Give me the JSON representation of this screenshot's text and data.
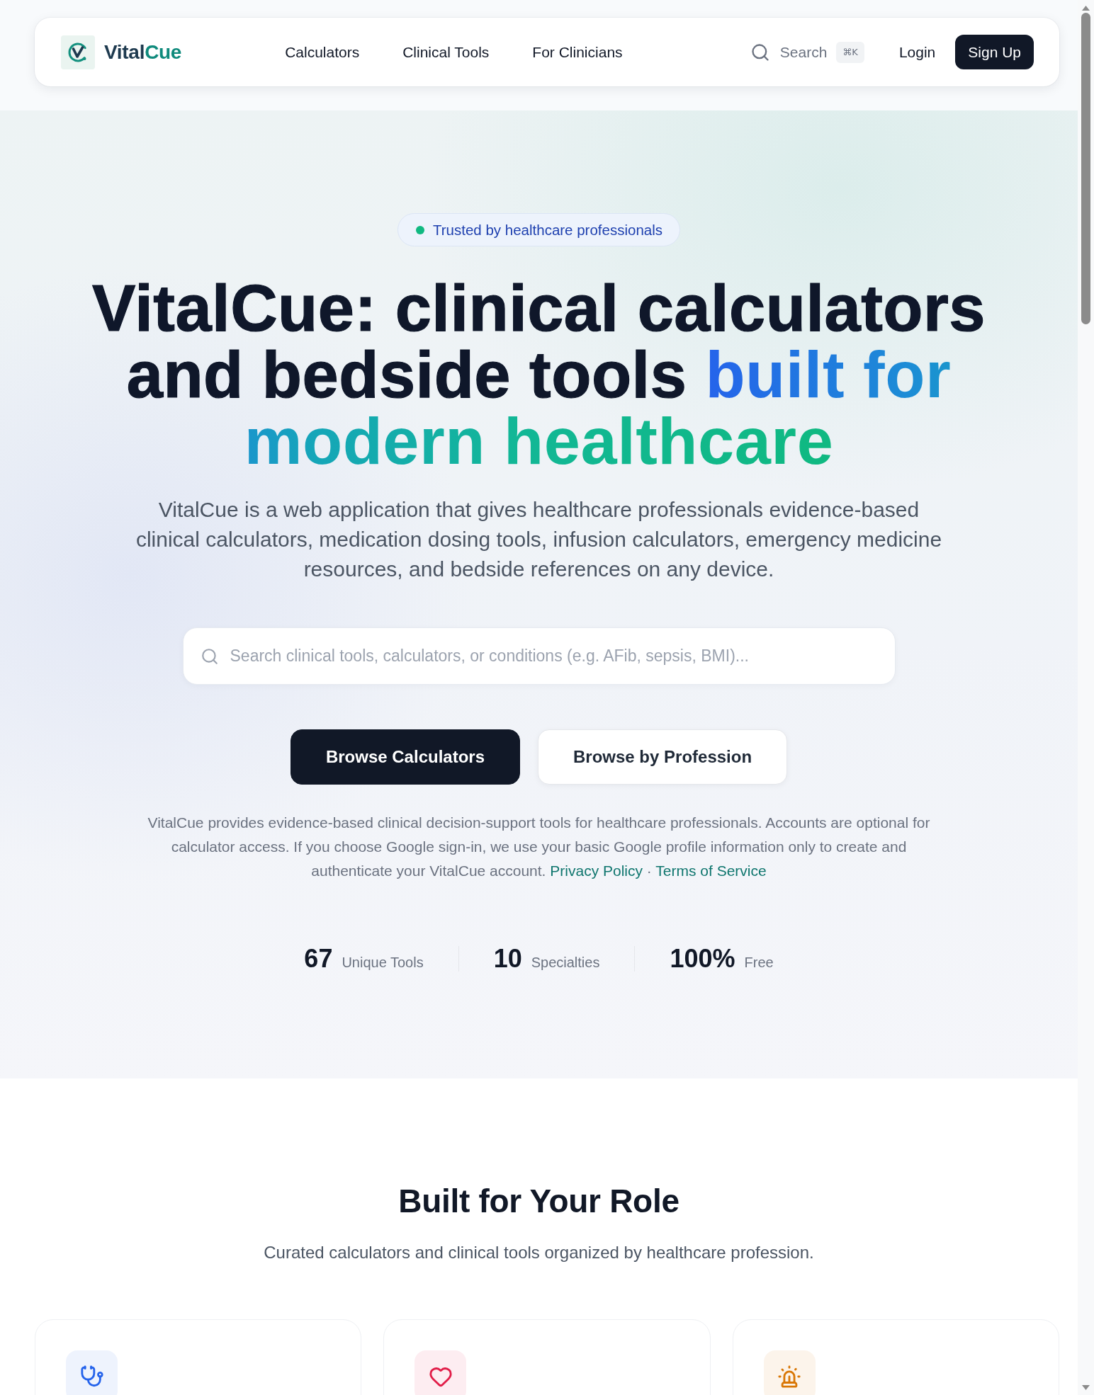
{
  "nav": {
    "brand": {
      "name": "Vital",
      "accent": "Cue"
    },
    "links": [
      {
        "label": "Calculators"
      },
      {
        "label": "Clinical Tools"
      },
      {
        "label": "For Clinicians"
      }
    ],
    "search": {
      "label": "Search",
      "shortcut": "⌘K"
    },
    "login": "Login",
    "signup": "Sign Up"
  },
  "hero": {
    "badge": "Trusted by healthcare professionals",
    "headline": "VitalCue: clinical calculators and bedside tools",
    "headline_highlight": "built for modern healthcare",
    "lead": "VitalCue is a web application that gives healthcare professionals evidence-based clinical calculators, medication dosing tools, infusion calculators, emergency medicine resources, and bedside references on any device.",
    "search": {
      "placeholder": "Search clinical tools, calculators, or conditions (e.g. AFib, sepsis, BMI)..."
    },
    "buttons": [
      {
        "label": "Browse Calculators",
        "kind": "primary"
      },
      {
        "label": "Browse by Profession",
        "kind": "secondary"
      }
    ],
    "disclaimer": {
      "text": "VitalCue provides evidence-based clinical decision-support tools for healthcare professionals. Accounts are optional for calculator access. If you choose Google sign-in, we use your basic Google profile information only to create and authenticate your VitalCue account.",
      "links": [
        {
          "label": "Privacy Policy"
        },
        {
          "label": "Terms of Service"
        }
      ],
      "separator": "·"
    },
    "stats": [
      {
        "value": "67",
        "label": "Unique Tools"
      },
      {
        "value": "10",
        "label": "Specialties"
      },
      {
        "value": "100%",
        "label": "Free"
      }
    ]
  },
  "roles": {
    "title": "Built for Your Role",
    "subtitle": "Curated calculators and clinical tools organized by healthcare profession.",
    "cards": [
      {
        "color": "#2563eb"
      },
      {
        "color": "#e11d48"
      },
      {
        "color": "#d97706"
      }
    ]
  }
}
